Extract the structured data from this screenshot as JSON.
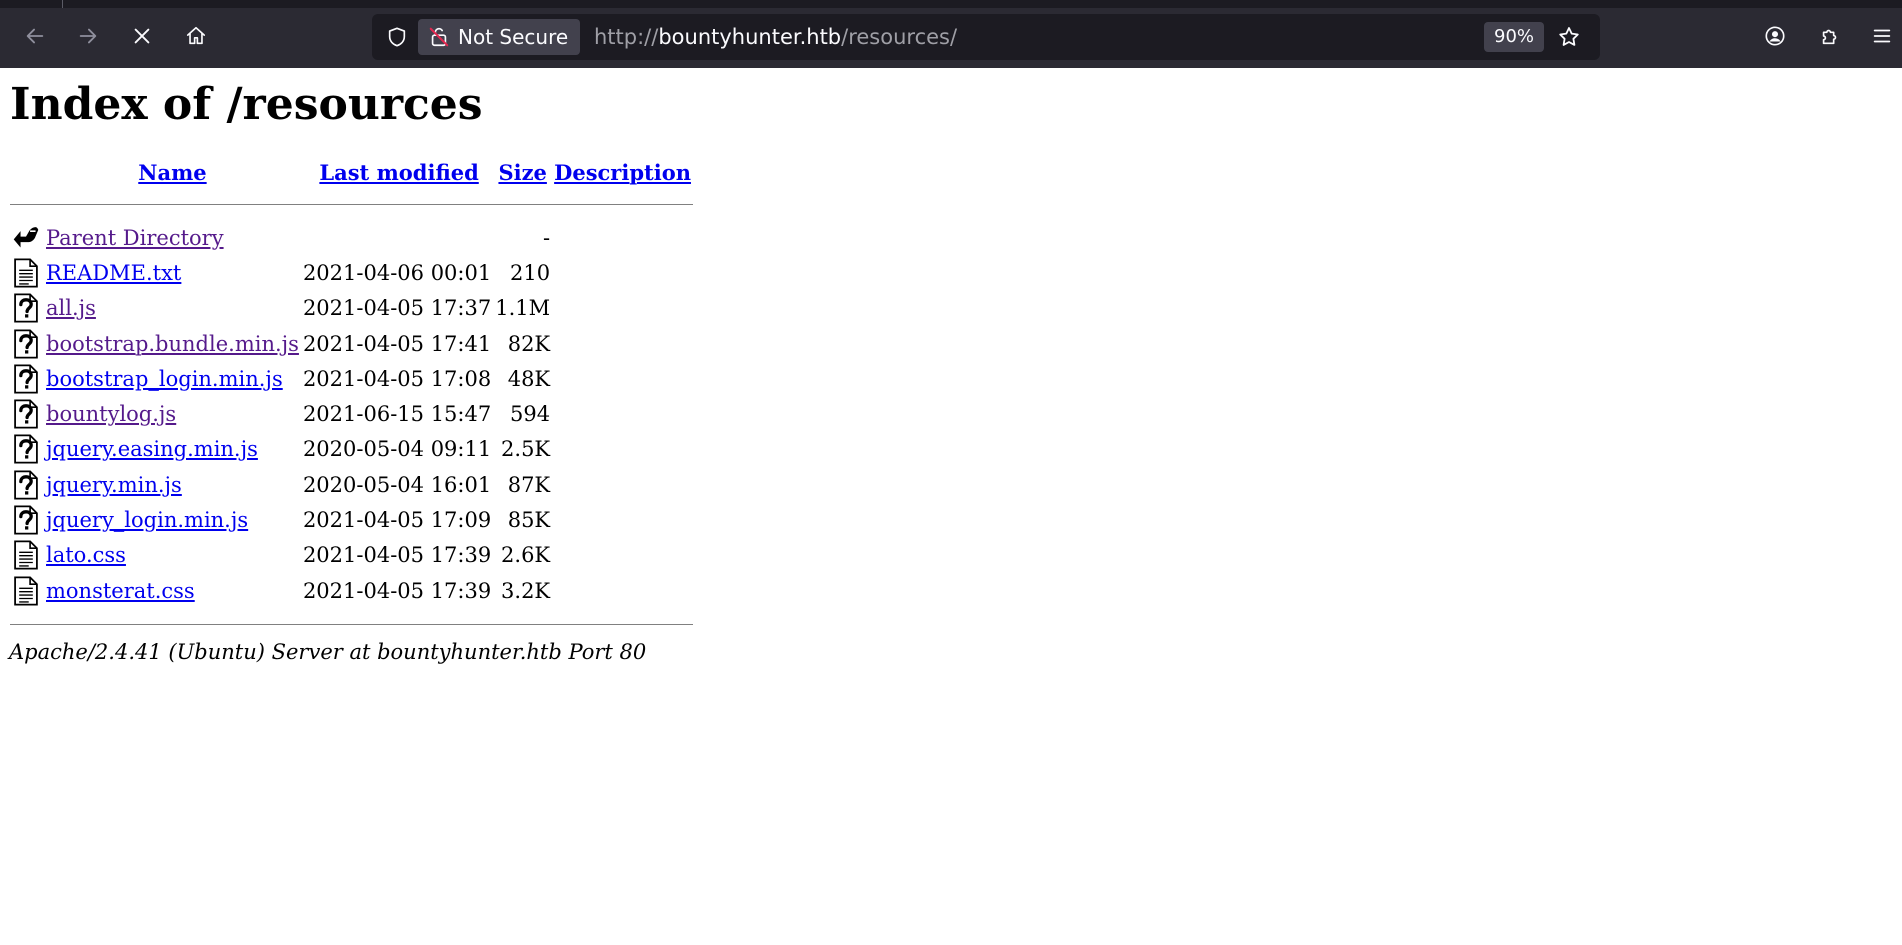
{
  "browser": {
    "url_security_label": "Not Secure",
    "url_scheme": "http://",
    "url_host": "bountyhunter.htb",
    "url_path": "/resources/",
    "zoom": "90%"
  },
  "page": {
    "title": "Index of /resources",
    "columns": {
      "name": "Name",
      "last_modified": "Last modified",
      "size": "Size",
      "description": "Description"
    },
    "rows": [
      {
        "icon": "back-icon",
        "name": "Parent Directory",
        "modified": "",
        "size": "-",
        "visited": true
      },
      {
        "icon": "text-file-icon",
        "name": "README.txt",
        "modified": "2021-04-06 00:01",
        "size": "210",
        "visited": false
      },
      {
        "icon": "unknown-file-icon",
        "name": "all.js",
        "modified": "2021-04-05 17:37",
        "size": "1.1M",
        "visited": true
      },
      {
        "icon": "unknown-file-icon",
        "name": "bootstrap.bundle.min.js",
        "modified": "2021-04-05 17:41",
        "size": "82K",
        "visited": true
      },
      {
        "icon": "unknown-file-icon",
        "name": "bootstrap_login.min.js",
        "modified": "2021-04-05 17:08",
        "size": "48K",
        "visited": false
      },
      {
        "icon": "unknown-file-icon",
        "name": "bountylog.js",
        "modified": "2021-06-15 15:47",
        "size": "594",
        "visited": true
      },
      {
        "icon": "unknown-file-icon",
        "name": "jquery.easing.min.js",
        "modified": "2020-05-04 09:11",
        "size": "2.5K",
        "visited": false
      },
      {
        "icon": "unknown-file-icon",
        "name": "jquery.min.js",
        "modified": "2020-05-04 16:01",
        "size": "87K",
        "visited": false
      },
      {
        "icon": "unknown-file-icon",
        "name": "jquery_login.min.js",
        "modified": "2021-04-05 17:09",
        "size": "85K",
        "visited": false
      },
      {
        "icon": "text-file-icon",
        "name": "lato.css",
        "modified": "2021-04-05 17:39",
        "size": "2.6K",
        "visited": false
      },
      {
        "icon": "text-file-icon",
        "name": "monsterat.css",
        "modified": "2021-04-05 17:39",
        "size": "3.2K",
        "visited": false
      }
    ],
    "footer": "Apache/2.4.41 (Ubuntu) Server at bountyhunter.htb Port 80"
  },
  "colors": {
    "toolbar_bg": "#2b2a33",
    "urlbar_bg": "#1c1b22",
    "link": "#0000ee",
    "link_visited": "#551a8b"
  }
}
